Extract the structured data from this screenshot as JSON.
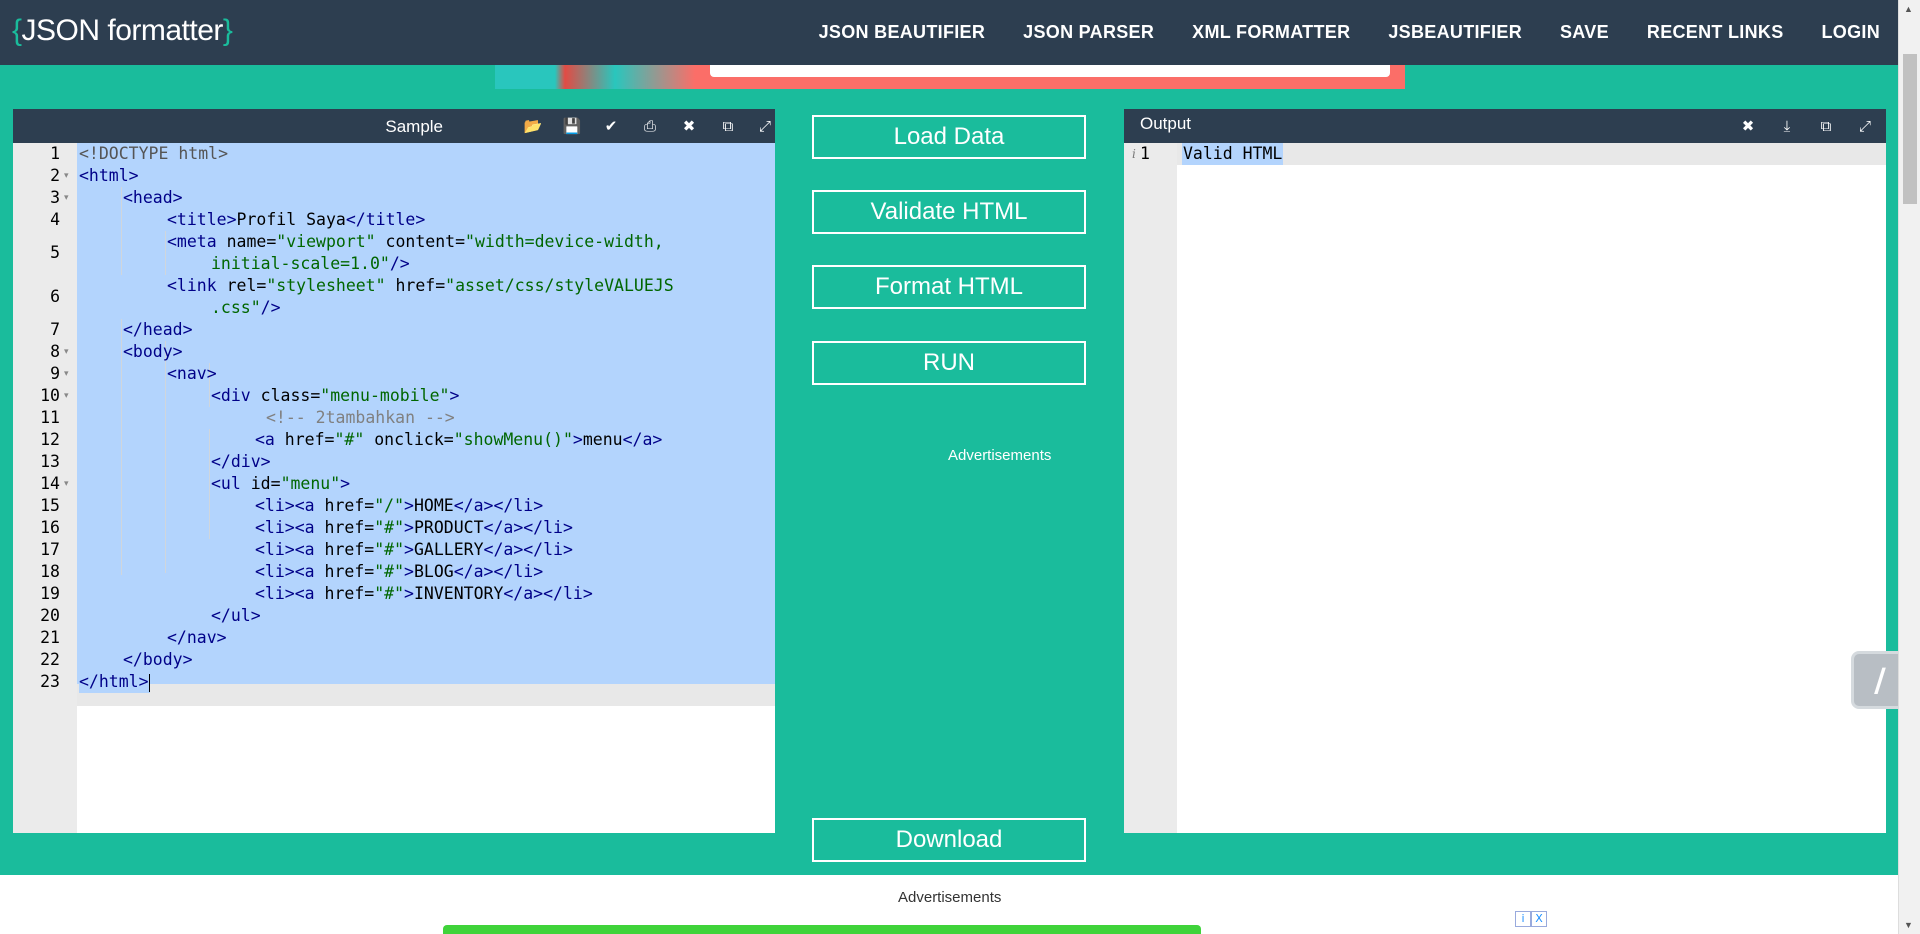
{
  "header": {
    "logo_open": "{",
    "logo_text": "JSON formatter",
    "logo_close": "}",
    "nav": [
      "JSON BEAUTIFIER",
      "JSON PARSER",
      "XML FORMATTER",
      "JSBEAUTIFIER",
      "SAVE",
      "RECENT LINKS",
      "LOGIN"
    ]
  },
  "input_panel": {
    "title": "Sample",
    "tools": [
      "folder-open-icon",
      "save-icon",
      "check-icon",
      "print-icon",
      "close-icon",
      "copy-icon",
      "fullscreen-icon"
    ]
  },
  "output_panel": {
    "title": "Output",
    "tools": [
      "close-icon",
      "download-icon",
      "copy-icon",
      "fullscreen-icon"
    ],
    "line_number": "1",
    "info_icon": "i",
    "text": "Valid HTML"
  },
  "actions": {
    "load": "Load Data",
    "validate": "Validate HTML",
    "format": "Format HTML",
    "run": "RUN",
    "download": "Download"
  },
  "ads": {
    "middle_label": "Advertisements",
    "bottom_label": "Advertisements",
    "badge_info": "i",
    "badge_close": "X"
  },
  "colors": {
    "header_bg": "#2d3e50",
    "accent": "#1abc9c",
    "selection": "#b3d4fd"
  },
  "code_lines": [
    {
      "num": "1",
      "fold": false
    },
    {
      "num": "2",
      "fold": true
    },
    {
      "num": "3",
      "fold": true
    },
    {
      "num": "4",
      "fold": false
    },
    {
      "num": "5",
      "fold": false
    },
    {
      "num": "6",
      "fold": false
    },
    {
      "num": "7",
      "fold": false
    },
    {
      "num": "8",
      "fold": true
    },
    {
      "num": "9",
      "fold": true
    },
    {
      "num": "10",
      "fold": true
    },
    {
      "num": "11",
      "fold": false
    },
    {
      "num": "12",
      "fold": false
    },
    {
      "num": "13",
      "fold": false
    },
    {
      "num": "14",
      "fold": true
    },
    {
      "num": "15",
      "fold": false
    },
    {
      "num": "16",
      "fold": false
    },
    {
      "num": "17",
      "fold": false
    },
    {
      "num": "18",
      "fold": false
    },
    {
      "num": "19",
      "fold": false
    },
    {
      "num": "20",
      "fold": false
    },
    {
      "num": "21",
      "fold": false
    },
    {
      "num": "22",
      "fold": false
    },
    {
      "num": "23",
      "fold": false
    }
  ],
  "code": {
    "l1": "<!DOCTYPE html>",
    "l2_tag": "<html>",
    "l3_tag": "<head>",
    "l4_open": "<title>",
    "l4_text": "Profil Saya",
    "l4_close": "</title>",
    "l5_tag": "<meta",
    "l5_attr1": " name=",
    "l5_val1": "\"viewport\"",
    "l5_attr2": " content=",
    "l5_val2a": "\"width=device-width,",
    "l5_val2b": "initial-scale=1.0\"",
    "l5_end": "/>",
    "l6_tag": "<link",
    "l6_attr1": " rel=",
    "l6_val1": "\"stylesheet\"",
    "l6_attr2": " href=",
    "l6_val2a": "\"asset/css/styleVALUEJS",
    "l6_val2b": ".css\"",
    "l6_end": "/>",
    "l7_tag": "</head>",
    "l8_tag": "<body>",
    "l9_tag": "<nav>",
    "l10_tag": "<div",
    "l10_attr": " class=",
    "l10_val": "\"menu-mobile\"",
    "l10_end": ">",
    "l11_com": "<!-- 2tambahkan -->",
    "l12_tag": "<a",
    "l12_attr1": " href=",
    "l12_val1": "\"#\"",
    "l12_attr2": " onclick=",
    "l12_val2": "\"showMenu()\"",
    "l12_gt": ">",
    "l12_text": "menu",
    "l12_close": "</a>",
    "l13_tag": "</div>",
    "l14_tag": "<ul",
    "l14_attr": " id=",
    "l14_val": "\"menu\"",
    "l14_end": ">",
    "li_open": "<li><a",
    "li_attr": " href=",
    "li_gt": ">",
    "li_close": "</a></li>",
    "l15_val": "\"/\"",
    "l15_text": "HOME",
    "l16_val": "\"#\"",
    "l16_text": "PRODUCT",
    "l17_val": "\"#\"",
    "l17_text": "GALLERY",
    "l18_val": "\"#\"",
    "l18_text": "BLOG",
    "l19_val": "\"#\"",
    "l19_text": "INVENTORY",
    "l20_tag": "</ul>",
    "l21_tag": "</nav>",
    "l22_tag": "</body>",
    "l23_tag": "</html>"
  }
}
